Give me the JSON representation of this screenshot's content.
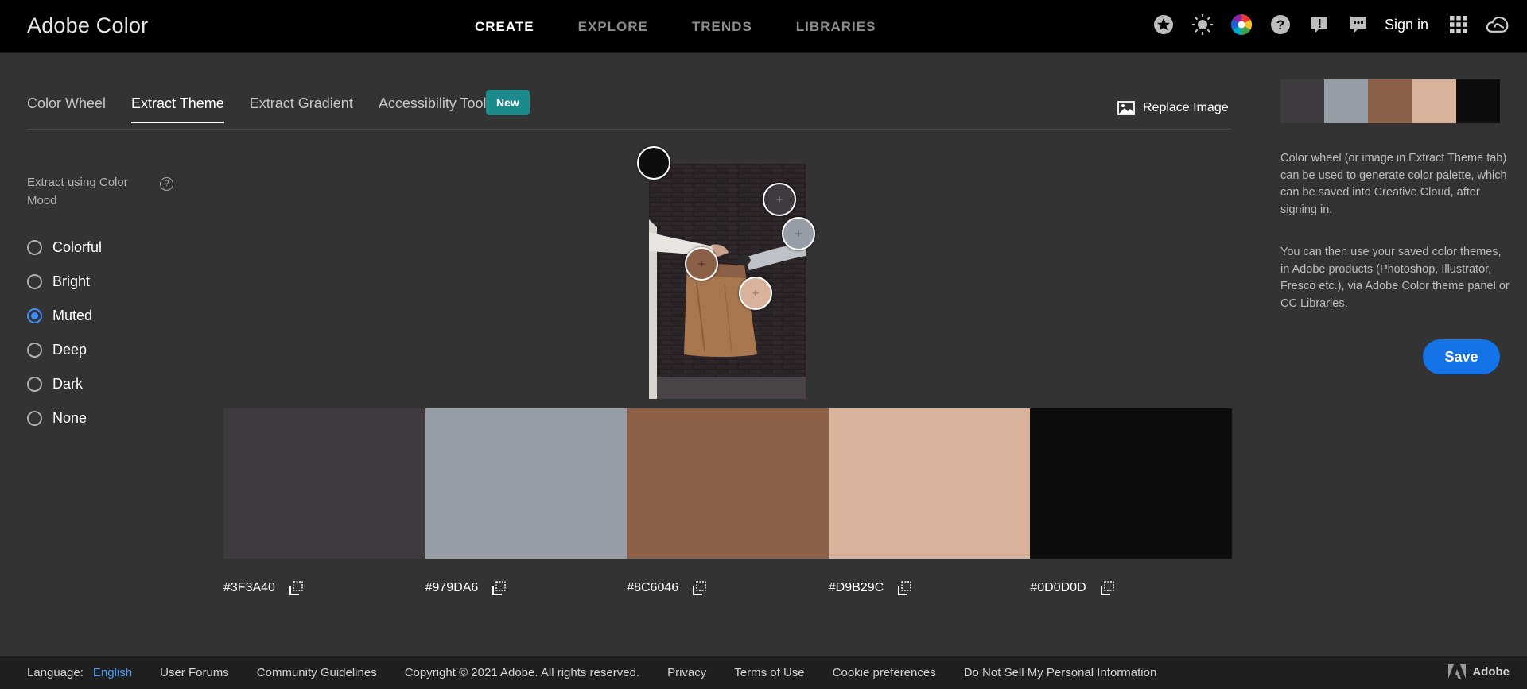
{
  "header": {
    "brand": "Adobe Color",
    "nav": [
      {
        "label": "CREATE",
        "active": true
      },
      {
        "label": "EXPLORE",
        "active": false
      },
      {
        "label": "TRENDS",
        "active": false
      },
      {
        "label": "LIBRARIES",
        "active": false
      }
    ],
    "icons": [
      "star-icon",
      "sun-icon",
      "color-wheel-icon",
      "help-icon",
      "feedback-icon",
      "chat-icon",
      "apps-grid-icon",
      "creative-cloud-icon"
    ],
    "sign_in": "Sign in"
  },
  "tabs": [
    {
      "label": "Color Wheel",
      "active": false
    },
    {
      "label": "Extract Theme",
      "active": true
    },
    {
      "label": "Extract Gradient",
      "active": false
    },
    {
      "label": "Accessibility Tools",
      "active": false
    }
  ],
  "new_badge": "New",
  "replace_image": "Replace Image",
  "mood": {
    "heading": "Extract using Color Mood",
    "help": "?",
    "options": [
      {
        "label": "Colorful",
        "checked": false
      },
      {
        "label": "Bright",
        "checked": false
      },
      {
        "label": "Muted",
        "checked": true
      },
      {
        "label": "Deep",
        "checked": false
      },
      {
        "label": "Dark",
        "checked": false
      },
      {
        "label": "None",
        "checked": false
      }
    ]
  },
  "theme": {
    "swatches": [
      {
        "hex": "#3F3A40",
        "color": "#3f3a40"
      },
      {
        "hex": "#979DA6",
        "color": "#979da6"
      },
      {
        "hex": "#8C6046",
        "color": "#8c6046"
      },
      {
        "hex": "#D9B29C",
        "color": "#d9b29c"
      },
      {
        "hex": "#0D0D0D",
        "color": "#0d0d0d"
      }
    ]
  },
  "right_panel": {
    "info_1": "Color wheel (or image in Extract Theme tab) can be used to generate color palette, which can be saved into Creative Cloud, after signing in.",
    "info_2": "You can then use your saved color themes, in Adobe products (Photoshop, Illustrator, Fresco etc.), via Adobe Color theme panel or CC Libraries.",
    "save_label": "Save"
  },
  "footer": {
    "language_label": "Language:",
    "language_value": "English",
    "links": [
      "User Forums",
      "Community Guidelines",
      "Copyright © 2021 Adobe. All rights reserved.",
      "Privacy",
      "Terms of Use",
      "Cookie preferences",
      "Do Not Sell My Personal Information"
    ],
    "adobe": "Adobe"
  },
  "colors": {
    "accent": "#1473e6",
    "badge": "#1b8a8c",
    "radio_checked": "#3d8df5"
  }
}
